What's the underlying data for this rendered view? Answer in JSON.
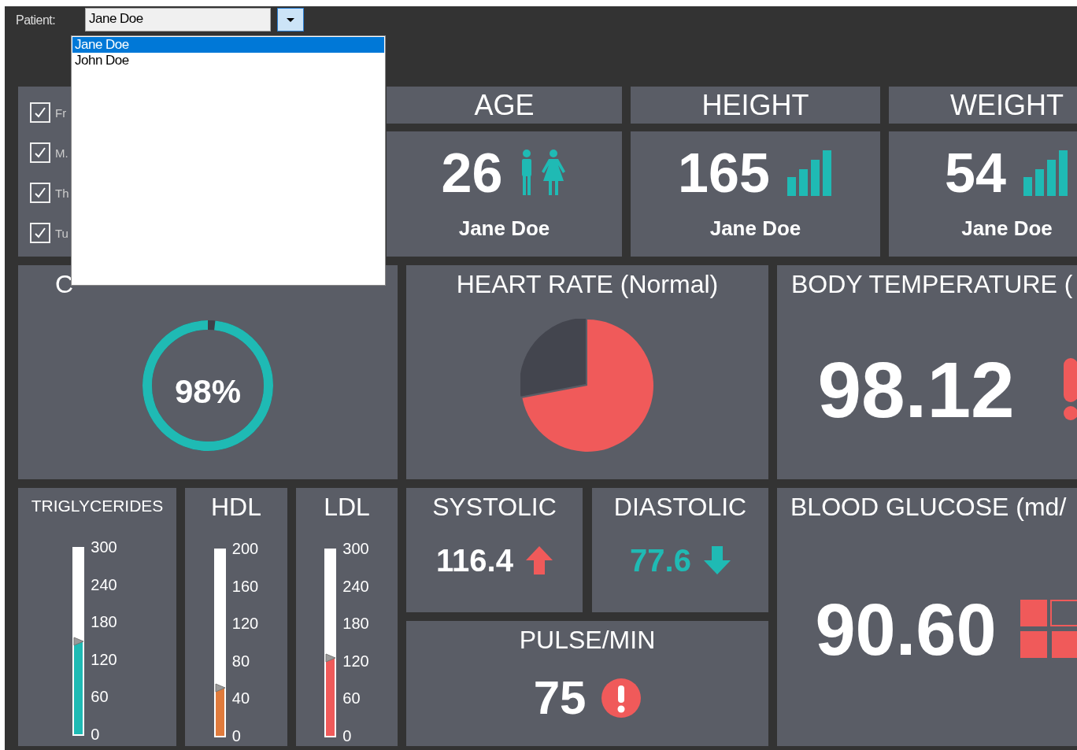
{
  "patient_selector": {
    "label": "Patient:",
    "value": "Jane Doe",
    "expanded": true,
    "options": [
      {
        "label": "Jane Doe",
        "selected": true
      },
      {
        "label": "John Doe",
        "selected": false
      }
    ]
  },
  "filters": [
    {
      "label": "Fr",
      "checked": true
    },
    {
      "label": "M.",
      "checked": true
    },
    {
      "label": "Th",
      "checked": true
    },
    {
      "label": "Tu",
      "checked": true
    }
  ],
  "stats": [
    {
      "kind": "gender",
      "title": "AGE",
      "value": "26",
      "name": "Jane Doe"
    },
    {
      "kind": "bars",
      "title": "HEIGHT",
      "value": "165",
      "name": "Jane Doe"
    },
    {
      "kind": "bars",
      "title": "WEIGHT",
      "value": "54",
      "name": "Jane Doe"
    }
  ],
  "cholesterol": {
    "title": "C",
    "level": 0.98,
    "reading": "98%"
  },
  "heart_rate": {
    "title": "HEART RATE (Normal)"
  },
  "body_temperature": {
    "title": "BODY TEMPERATURE (",
    "value": "98.12",
    "alert": true
  },
  "lipids": [
    {
      "title": "TRIGLYCERIDES",
      "ticks": [
        "300",
        "240",
        "180",
        "120",
        "60",
        "0"
      ],
      "level": 0.5,
      "color": "#1fbab4"
    },
    {
      "title": "HDL",
      "ticks": [
        "200",
        "160",
        "120",
        "80",
        "40",
        "0"
      ],
      "level": 0.26,
      "color": "#e07b3c"
    },
    {
      "title": "LDL",
      "ticks": [
        "300",
        "240",
        "180",
        "120",
        "60",
        "0"
      ],
      "level": 0.42,
      "color": "#f05a5a"
    }
  ],
  "blood_pressure": [
    {
      "title": "SYSTOLIC",
      "value": "116.4",
      "kind": "up"
    },
    {
      "title": "DIASTOLIC",
      "value": "77.6",
      "kind": "down"
    }
  ],
  "pulse": {
    "title": "PULSE/MIN",
    "value": "75",
    "alert": true
  },
  "blood_glucose": {
    "title": "BLOOD GLUCOSE (md/",
    "value": "90.60"
  }
}
